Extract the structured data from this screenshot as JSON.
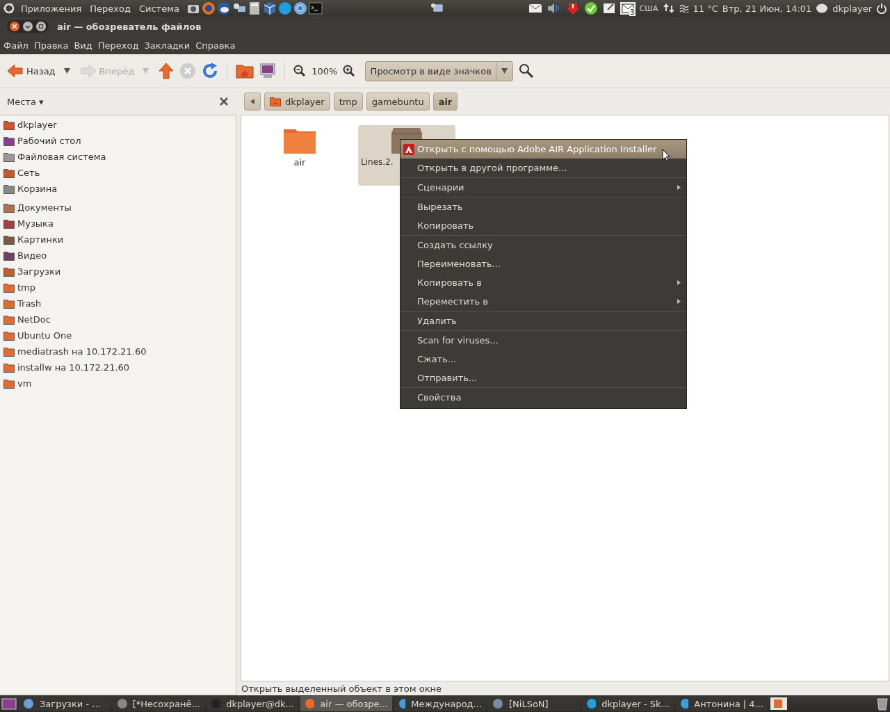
{
  "top_panel": {
    "menus": [
      "Приложения",
      "Переход",
      "Система"
    ],
    "keyboard": "США",
    "weather": "11 °C",
    "clock": "Втр, 21 Июн, 14:01",
    "user": "dkplayer",
    "mail_count": "3"
  },
  "window": {
    "title": "air — обозреватель файлов"
  },
  "menubar": [
    "Файл",
    "Правка",
    "Вид",
    "Переход",
    "Закладки",
    "Справка"
  ],
  "toolbar": {
    "back": {
      "label": "Назад",
      "disabled": false
    },
    "forward": {
      "label": "Вперёд",
      "disabled": true
    },
    "zoom": "100%",
    "view_mode": "Просмотр в виде значков"
  },
  "sidebar": {
    "title": "Места ▾",
    "groups": [
      [
        {
          "label": "dkplayer",
          "kind": "home"
        },
        {
          "label": "Рабочий стол",
          "kind": "desktop"
        },
        {
          "label": "Файловая система",
          "kind": "drive"
        },
        {
          "label": "Сеть",
          "kind": "network"
        },
        {
          "label": "Корзина",
          "kind": "trash"
        }
      ],
      [
        {
          "label": "Документы",
          "kind": "documents"
        },
        {
          "label": "Музыка",
          "kind": "music"
        },
        {
          "label": "Картинки",
          "kind": "pictures"
        },
        {
          "label": "Видео",
          "kind": "video"
        },
        {
          "label": "Загрузки",
          "kind": "downloads"
        },
        {
          "label": "tmp",
          "kind": "folder"
        },
        {
          "label": "Trash",
          "kind": "folder"
        },
        {
          "label": "NetDoc",
          "kind": "folder"
        },
        {
          "label": "Ubuntu One",
          "kind": "folder"
        },
        {
          "label": "mediatrash на 10.172.21.60",
          "kind": "folder"
        },
        {
          "label": "installw на 10.172.21.60",
          "kind": "folder"
        },
        {
          "label": "vm",
          "kind": "folder"
        }
      ]
    ]
  },
  "pathbar": [
    {
      "label": "dkplayer",
      "kind": "home",
      "selected": false
    },
    {
      "label": "tmp",
      "kind": "plain",
      "selected": false
    },
    {
      "label": "gamebuntu",
      "kind": "plain",
      "selected": false
    },
    {
      "label": "air",
      "kind": "plain",
      "selected": true
    }
  ],
  "files": [
    {
      "name": "air",
      "kind": "folder",
      "selected": false
    },
    {
      "name": "Lines.2.",
      "kind": "package",
      "selected": true
    }
  ],
  "context_menu": [
    {
      "label": "Открыть с помощью Adobe AIR Application Installer",
      "kind": "app",
      "selected": true,
      "submenu": false,
      "separator_before": false
    },
    {
      "label": "Открыть в другой программе...",
      "kind": "plain",
      "selected": false,
      "submenu": false,
      "separator_before": false
    },
    {
      "label": "Сценарии",
      "kind": "plain",
      "selected": false,
      "submenu": true,
      "separator_before": true
    },
    {
      "label": "Вырезать",
      "kind": "plain",
      "selected": false,
      "submenu": false,
      "separator_before": true
    },
    {
      "label": "Копировать",
      "kind": "plain",
      "selected": false,
      "submenu": false,
      "separator_before": false
    },
    {
      "label": "Создать ссылку",
      "kind": "plain",
      "selected": false,
      "submenu": false,
      "separator_before": true
    },
    {
      "label": "Переименовать...",
      "kind": "plain",
      "selected": false,
      "submenu": false,
      "separator_before": false
    },
    {
      "label": "Копировать в",
      "kind": "plain",
      "selected": false,
      "submenu": true,
      "separator_before": false
    },
    {
      "label": "Переместить в",
      "kind": "plain",
      "selected": false,
      "submenu": true,
      "separator_before": false
    },
    {
      "label": "Удалить",
      "kind": "plain",
      "selected": false,
      "submenu": false,
      "separator_before": true
    },
    {
      "label": "Scan for viruses...",
      "kind": "plain",
      "selected": false,
      "submenu": false,
      "separator_before": true
    },
    {
      "label": "Сжать...",
      "kind": "plain",
      "selected": false,
      "submenu": false,
      "separator_before": false
    },
    {
      "label": "Отправить...",
      "kind": "plain",
      "selected": false,
      "submenu": false,
      "separator_before": false
    },
    {
      "label": "Свойства",
      "kind": "plain",
      "selected": false,
      "submenu": false,
      "separator_before": true
    }
  ],
  "status_bar": "Открыть выделенный объект в этом окне",
  "taskbar": [
    {
      "label": "Загрузки - ...",
      "kind": "browser",
      "selected": false
    },
    {
      "label": "[*Несохранё...",
      "kind": "editor",
      "selected": false
    },
    {
      "label": "dkplayer@dk...",
      "kind": "terminal",
      "selected": false
    },
    {
      "label": "air — обозре...",
      "kind": "files",
      "selected": true
    },
    {
      "label": "Международ...",
      "kind": "chat",
      "selected": false
    },
    {
      "label": "[NiLSoN]",
      "kind": "clock",
      "selected": false
    },
    {
      "label": "dkplayer - Sk...",
      "kind": "skype",
      "selected": false
    },
    {
      "label": "Антонина | 4...",
      "kind": "chat",
      "selected": false
    }
  ]
}
